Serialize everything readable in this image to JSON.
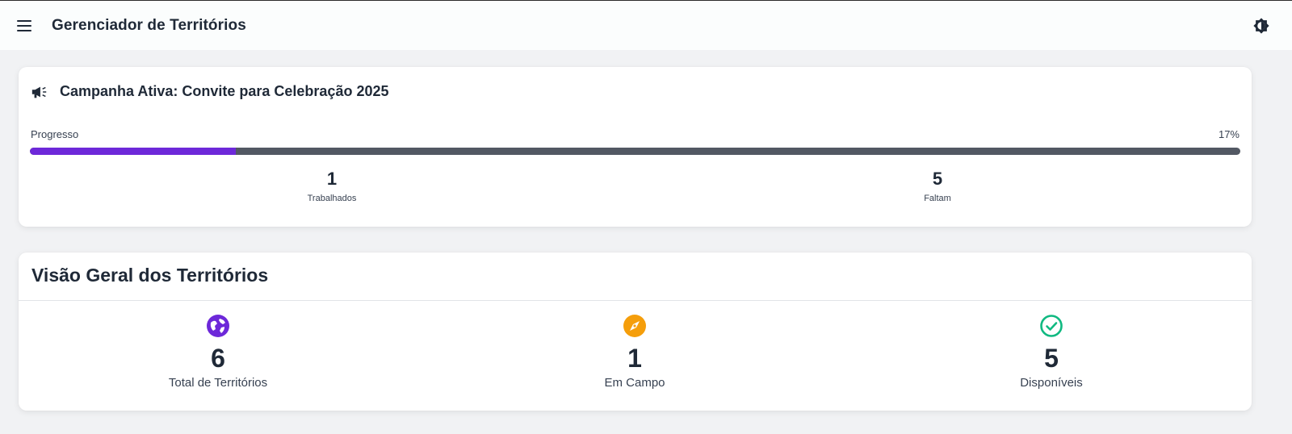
{
  "header": {
    "menu_icon": "menu-icon",
    "title": "Gerenciador de Territórios",
    "theme_icon": "theme-toggle-icon"
  },
  "campaign": {
    "icon": "megaphone-icon",
    "title": "Campanha Ativa: Convite para Celebração 2025",
    "progress_label": "Progresso",
    "progress_text": "17%",
    "progress_value": 0.17,
    "worked": {
      "value": "1",
      "label": "Trabalhados"
    },
    "remaining": {
      "value": "5",
      "label": "Faltam"
    },
    "colors": {
      "fill": "#6d28d9",
      "track": "#525863"
    }
  },
  "overview": {
    "title": "Visão Geral dos Territórios",
    "stats": [
      {
        "icon": "globe-icon",
        "color": "#6d28d9",
        "value": "6",
        "label": "Total de Territórios"
      },
      {
        "icon": "compass-icon",
        "color": "#f59e0b",
        "value": "1",
        "label": "Em Campo"
      },
      {
        "icon": "check-circle-icon",
        "color": "#10b981",
        "value": "5",
        "label": "Disponíveis"
      }
    ]
  }
}
